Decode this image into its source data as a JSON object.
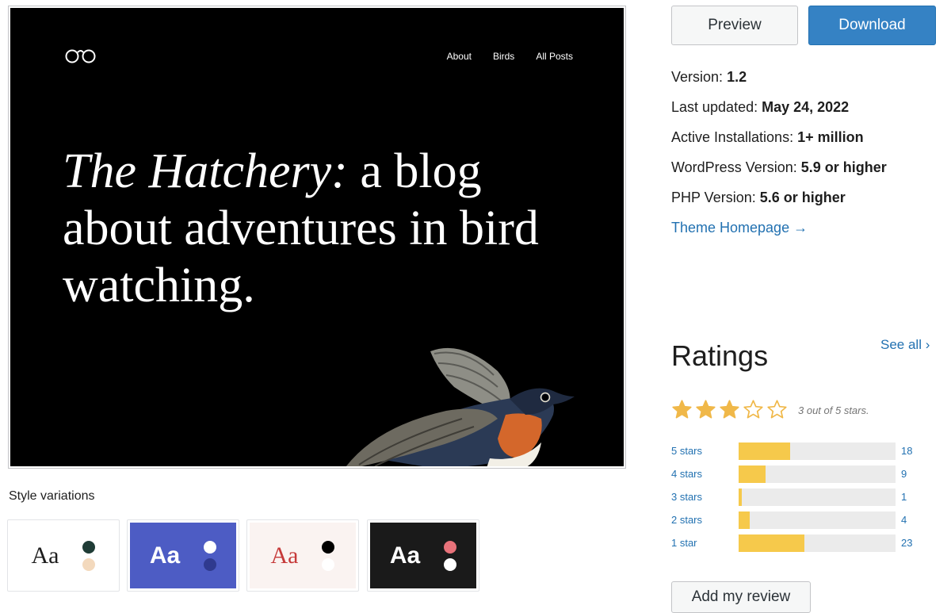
{
  "theme_preview": {
    "nav": [
      "About",
      "Birds",
      "All Posts"
    ],
    "heading_italic": "The Hatchery:",
    "heading_rest": "a blog about adventures in bird watching."
  },
  "style_variations": {
    "label": "Style variations",
    "items": [
      {
        "aa": "Aa",
        "bg": "#ffffff",
        "text_color": "#1e1e1e",
        "dot1": "#1f3c36",
        "dot2": "#f3d9bd"
      },
      {
        "aa": "Aa",
        "bg": "#4d5cc4",
        "text_color": "#ffffff",
        "dot1": "#ffffff",
        "dot2": "#2f3a8f"
      },
      {
        "aa": "Aa",
        "bg": "#faf3f1",
        "text_color": "#c63a3a",
        "dot1": "#000000",
        "dot2": "#ffffff"
      },
      {
        "aa": "Aa",
        "bg": "#1a1a1a",
        "text_color": "#ffffff",
        "dot1": "#e8727a",
        "dot2": "#ffffff"
      }
    ]
  },
  "actions": {
    "preview": "Preview",
    "download": "Download"
  },
  "meta": {
    "version_label": "Version:",
    "version": "1.2",
    "updated_label": "Last updated:",
    "updated": "May 24, 2022",
    "installs_label": "Active Installations:",
    "installs": "1+ million",
    "wp_label": "WordPress Version:",
    "wp": "5.9 or higher",
    "php_label": "PHP Version:",
    "php": "5.6 or higher",
    "homepage": "Theme Homepage →"
  },
  "ratings": {
    "title": "Ratings",
    "see_all": "See all ›",
    "score": 3,
    "max": 5,
    "score_text": "3 out of 5 stars.",
    "rows": [
      {
        "label": "5 stars",
        "count": "18",
        "fraction": 0.33
      },
      {
        "label": "4 stars",
        "count": "9",
        "fraction": 0.17
      },
      {
        "label": "3 stars",
        "count": "1",
        "fraction": 0.02
      },
      {
        "label": "2 stars",
        "count": "4",
        "fraction": 0.07
      },
      {
        "label": "1 star",
        "count": "23",
        "fraction": 0.42
      }
    ],
    "add_review": "Add my review"
  },
  "colors": {
    "accent": "#2271b1",
    "star": "#f0b849",
    "bar_fill": "#f6c94b"
  },
  "icons": [
    "binoculars-logo-icon",
    "bird-illustration",
    "star-icon",
    "arrow-right-icon",
    "chevron-right-icon"
  ]
}
